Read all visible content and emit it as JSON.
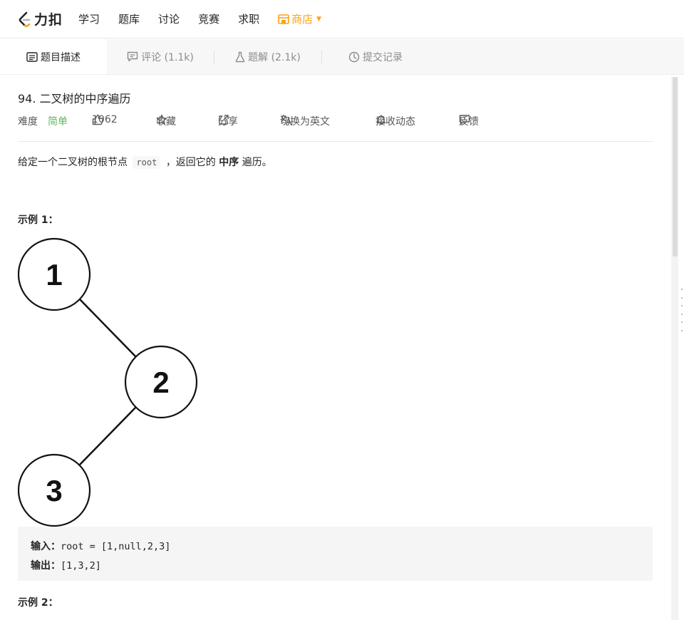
{
  "nav": {
    "logo_text": "力扣",
    "items": [
      "学习",
      "题库",
      "讨论",
      "竞赛",
      "求职"
    ],
    "store_label": "商店"
  },
  "tabs": [
    {
      "label": "题目描述",
      "icon": "description-icon"
    },
    {
      "label": "评论 (1.1k)",
      "icon": "comment-icon"
    },
    {
      "label": "题解 (2.1k)",
      "icon": "flask-icon"
    },
    {
      "label": "提交记录",
      "icon": "clock-icon"
    }
  ],
  "problem": {
    "title": "94. 二叉树的中序遍历",
    "difficulty_label": "难度",
    "difficulty": "简单",
    "likes": "1062",
    "favorite": "收藏",
    "share": "分享",
    "translate": "切换为英文",
    "subscribe": "接收动态",
    "feedback": "反馈",
    "desc_prefix": "给定一个二叉树的根节点",
    "desc_code": "root",
    "desc_mid": "，返回它的",
    "desc_bold": "中序",
    "desc_suffix": "遍历。"
  },
  "example1": {
    "title": "示例 1：",
    "tree_nodes": [
      "1",
      "2",
      "3"
    ],
    "input_label": "输入：",
    "input_value": "root = [1,null,2,3]",
    "output_label": "输出：",
    "output_value": "[1,3,2]"
  },
  "example2": {
    "title": "示例 2："
  },
  "colors": {
    "brand_orange": "#ffa116",
    "easy_green": "#5cb85c"
  }
}
